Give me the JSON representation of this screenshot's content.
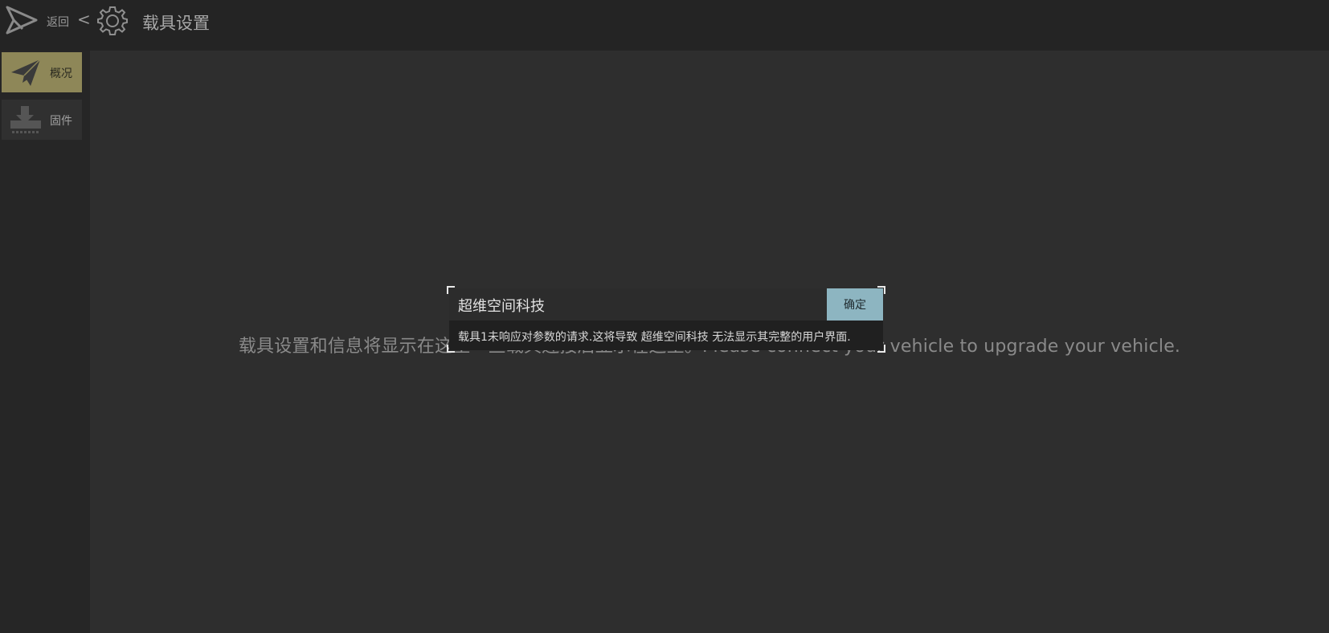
{
  "header": {
    "back_label": "返回",
    "back_chevron": "<",
    "title": "载具设置",
    "logo_icon": "paper-plane-outline-icon",
    "title_icon": "gear-icon"
  },
  "sidebar": {
    "items": [
      {
        "label": "概况",
        "icon": "paper-plane-icon",
        "active": true
      },
      {
        "label": "固件",
        "icon": "download-icon",
        "active": false
      }
    ]
  },
  "main": {
    "background_message": "载具设置和信息将显示在这里一旦载具连接后显示在这里。Please connect your vehicle to upgrade your vehicle."
  },
  "dialog": {
    "title": "超维空间科技",
    "ok_label": "确定",
    "message": "载具1未响应对参数的请求.这将导致 超维空间科技 无法显示其完整的用户界面."
  },
  "colors": {
    "topbar_bg": "#242424",
    "main_bg": "#2e2e2e",
    "active_nav": "#8e8758",
    "ok_button": "#8db5c1"
  }
}
